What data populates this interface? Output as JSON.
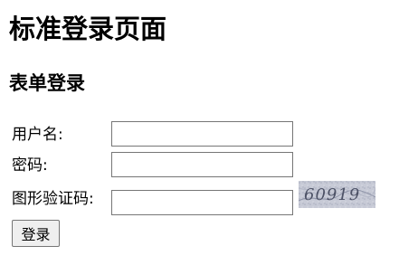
{
  "page": {
    "title": "标准登录页面",
    "section_title": "表单登录"
  },
  "form": {
    "username_label": "用户名:",
    "username_value": "",
    "password_label": "密码:",
    "password_value": "",
    "captcha_label": "图形验证码:",
    "captcha_value": "",
    "captcha_image_text": "60919",
    "submit_label": "登录"
  }
}
